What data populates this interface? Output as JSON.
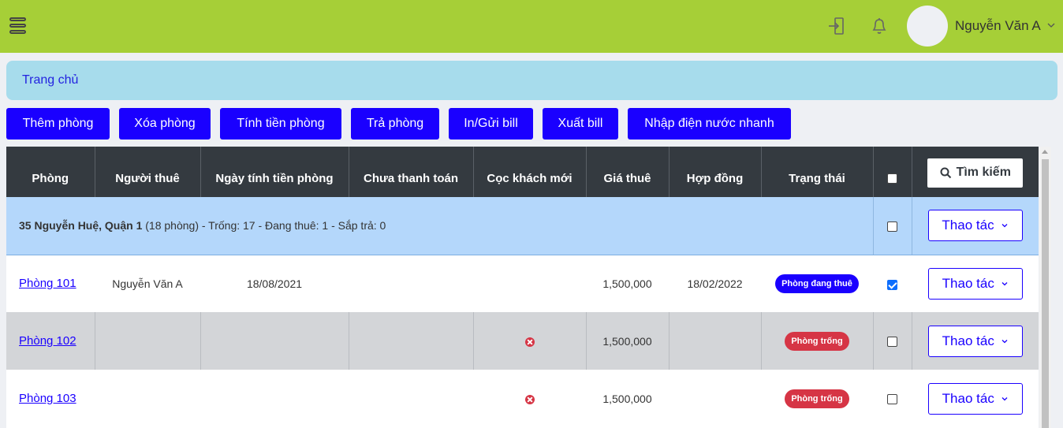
{
  "topbar": {
    "user_name": "Nguyễn Văn A",
    "icons": [
      "menu-icon",
      "logout-icon",
      "bell-icon",
      "chevron-down-icon"
    ]
  },
  "breadcrumb": {
    "home": "Trang chủ"
  },
  "actions": {
    "add_room": "Thêm phòng",
    "delete_room": "Xóa phòng",
    "calc_rent": "Tính tiền phòng",
    "return_room": "Trả phòng",
    "print_bill": "In/Gửi bill",
    "export_bill": "Xuất bill",
    "quick_utility": "Nhập điện nước nhanh"
  },
  "table": {
    "headers": {
      "room": "Phòng",
      "tenant": "Người thuê",
      "billing_date": "Ngày tính tiền phòng",
      "unpaid": "Chưa thanh toán",
      "deposit": "Cọc khách mới",
      "price": "Giá thuê",
      "contract": "Hợp đồng",
      "status": "Trạng thái",
      "search": "Tìm kiếm"
    },
    "group": {
      "name": "35 Nguyễn Huệ, Quận 1",
      "summary": "(18 phòng) - Trống: 17 - Đang thuê: 1 - Sắp trả: 0",
      "action": "Thao tác"
    },
    "rows": [
      {
        "room": "Phòng 101",
        "tenant": "Nguyễn Văn A",
        "billing_date": "18/08/2021",
        "unpaid": "",
        "deposit": "",
        "price": "1,500,000",
        "contract": "18/02/2022",
        "status": "Phòng đang thuê",
        "checked": true,
        "action": "Thao tác"
      },
      {
        "room": "Phòng 102",
        "tenant": "",
        "billing_date": "",
        "unpaid": "",
        "deposit": "x-circle-icon",
        "price": "1,500,000",
        "contract": "",
        "status": "Phòng trống",
        "checked": false,
        "action": "Thao tác"
      },
      {
        "room": "Phòng 103",
        "tenant": "",
        "billing_date": "",
        "unpaid": "",
        "deposit": "x-circle-icon",
        "price": "1,500,000",
        "contract": "",
        "status": "Phòng trống",
        "checked": false,
        "action": "Thao tác"
      }
    ]
  },
  "colors": {
    "topbar": "#a6cf37",
    "primary": "#1a00ff",
    "danger": "#d63545",
    "header_dark": "#343a40",
    "group_row": "#b4d7fb",
    "breadcrumb_bg": "#a7dcec"
  }
}
